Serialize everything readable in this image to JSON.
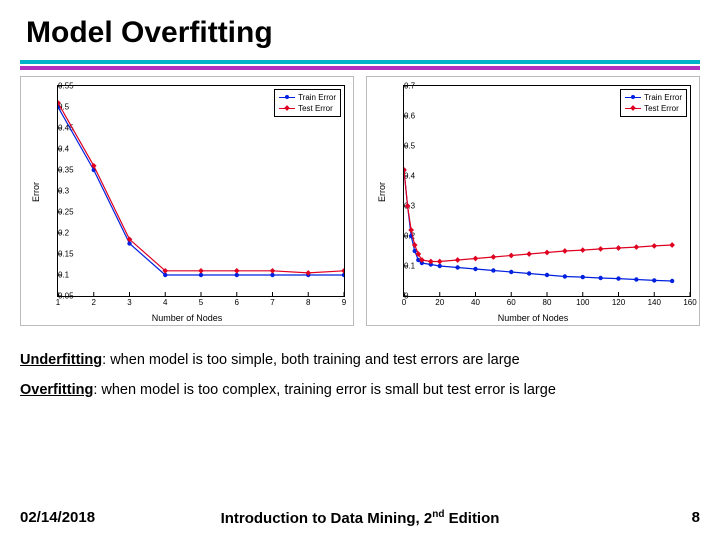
{
  "title": "Model Overfitting",
  "captions": {
    "underfit_term": "Underfitting",
    "underfit_text": ": when model is too simple, both training and test errors are large",
    "overfit_term": "Overfitting",
    "overfit_text": ": when model is too complex, training error is small but test error is large"
  },
  "footer": {
    "date": "02/14/2018",
    "center_a": "Introduction to Data Mining, 2",
    "center_sup": "nd",
    "center_b": " Edition",
    "page": "8"
  },
  "legend": {
    "train": "Train Error",
    "test": "Test Error"
  },
  "chart_data": [
    {
      "type": "line",
      "title": "",
      "xlabel": "Number of Nodes",
      "ylabel": "Error",
      "xlim": [
        1,
        9
      ],
      "ylim": [
        0.05,
        0.55
      ],
      "xticks": [
        1,
        2,
        3,
        4,
        5,
        6,
        7,
        8,
        9
      ],
      "yticks": [
        0.05,
        0.1,
        0.15,
        0.2,
        0.25,
        0.3,
        0.35,
        0.4,
        0.45,
        0.5,
        0.55
      ],
      "x": [
        1,
        2,
        3,
        4,
        5,
        6,
        7,
        8,
        9
      ],
      "series": [
        {
          "name": "Train Error",
          "values": [
            0.5,
            0.35,
            0.175,
            0.1,
            0.1,
            0.1,
            0.1,
            0.1,
            0.1
          ]
        },
        {
          "name": "Test Error",
          "values": [
            0.51,
            0.36,
            0.185,
            0.11,
            0.11,
            0.11,
            0.11,
            0.105,
            0.11
          ]
        }
      ]
    },
    {
      "type": "line",
      "title": "",
      "xlabel": "Number of Nodes",
      "ylabel": "Error",
      "xlim": [
        0,
        160
      ],
      "ylim": [
        0,
        0.7
      ],
      "xticks": [
        0,
        20,
        40,
        60,
        80,
        100,
        120,
        140,
        160
      ],
      "yticks": [
        0,
        0.1,
        0.2,
        0.3,
        0.4,
        0.5,
        0.6,
        0.7
      ],
      "x": [
        0,
        2,
        4,
        6,
        8,
        10,
        15,
        20,
        30,
        40,
        50,
        60,
        70,
        80,
        90,
        100,
        110,
        120,
        130,
        140,
        150
      ],
      "series": [
        {
          "name": "Train Error",
          "values": [
            0.42,
            0.3,
            0.2,
            0.15,
            0.12,
            0.11,
            0.105,
            0.1,
            0.095,
            0.09,
            0.085,
            0.08,
            0.075,
            0.07,
            0.065,
            0.063,
            0.06,
            0.058,
            0.055,
            0.052,
            0.05
          ]
        },
        {
          "name": "Test Error",
          "values": [
            0.42,
            0.3,
            0.22,
            0.17,
            0.14,
            0.12,
            0.115,
            0.115,
            0.12,
            0.125,
            0.13,
            0.135,
            0.14,
            0.145,
            0.15,
            0.153,
            0.157,
            0.16,
            0.163,
            0.167,
            0.17
          ]
        }
      ]
    }
  ]
}
